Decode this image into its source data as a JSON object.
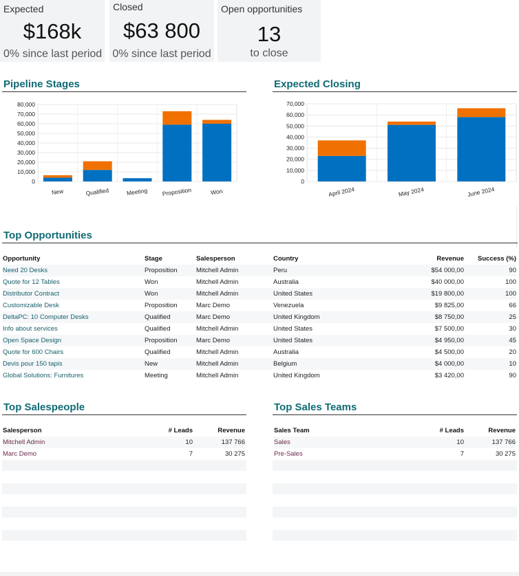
{
  "kpis": {
    "expected": {
      "label": "Expected",
      "value": "$168k",
      "sub": "0% since last period"
    },
    "closed": {
      "label": "Closed",
      "value": "$63 800",
      "sub": "0% since last period"
    },
    "open": {
      "label": "Open opportunities",
      "value": "13",
      "sub": "to close"
    }
  },
  "sections": {
    "pipeline": "Pipeline Stages",
    "closing": "Expected Closing",
    "top_opps": "Top Opportunities",
    "top_salespeople": "Top Salespeople",
    "top_teams": "Top Sales Teams"
  },
  "colors": {
    "primary": "#0070c0",
    "secondary": "#f07100",
    "title": "#0f6b73"
  },
  "chart_data": [
    {
      "type": "bar",
      "title": "Pipeline Stages",
      "stacked": true,
      "categories": [
        "New",
        "Qualified",
        "Meeting",
        "Proposition",
        "Won"
      ],
      "series": [
        {
          "values": [
            4000,
            12000,
            3420,
            59000,
            60000
          ]
        },
        {
          "values": [
            2500,
            9000,
            0,
            14000,
            4000
          ]
        }
      ],
      "ylim": [
        0,
        80000
      ],
      "y_ticks": [
        "80,000",
        "70,000",
        "60,000",
        "50,000",
        "40,000",
        "30,000",
        "20,000",
        "10,000",
        "0"
      ]
    },
    {
      "type": "bar",
      "title": "Expected Closing",
      "stacked": true,
      "categories": [
        "April 2024",
        "May 2024",
        "June 2024"
      ],
      "series": [
        {
          "values": [
            23000,
            51000,
            58000
          ]
        },
        {
          "values": [
            14000,
            3000,
            8000
          ]
        }
      ],
      "ylim": [
        0,
        70000
      ],
      "y_ticks": [
        "70,000",
        "60,000",
        "50,000",
        "40,000",
        "30,000",
        "20,000",
        "10,000",
        "0"
      ]
    }
  ],
  "opportunities": {
    "headers": {
      "opportunity": "Opportunity",
      "stage": "Stage",
      "salesperson": "Salesperson",
      "country": "Country",
      "revenue": "Revenue",
      "success": "Success (%)"
    },
    "rows": [
      [
        "Need 20 Desks",
        "Proposition",
        "Mitchell Admin",
        "Peru",
        "$54 000,00",
        "90"
      ],
      [
        "Quote for 12 Tables",
        "Won",
        "Mitchell Admin",
        "Australia",
        "$40 000,00",
        "100"
      ],
      [
        "Distributor Contract",
        "Won",
        "Mitchell Admin",
        "United States",
        "$19 800,00",
        "100"
      ],
      [
        "Customizable Desk",
        "Proposition",
        "Marc Demo",
        "Venezuela",
        "$9 825,00",
        "66"
      ],
      [
        "DeltaPC: 10 Computer Desks",
        "Qualified",
        "Marc Demo",
        "United Kingdom",
        "$8 750,00",
        "25"
      ],
      [
        "Info about services",
        "Qualified",
        "Mitchell Admin",
        "United States",
        "$7 500,00",
        "30"
      ],
      [
        "Open Space Design",
        "Proposition",
        "Marc Demo",
        "United States",
        "$4 950,00",
        "45"
      ],
      [
        "Quote for 600 Chairs",
        "Qualified",
        "Mitchell Admin",
        "Australia",
        "$4 500,00",
        "20"
      ],
      [
        "Devis pour 150 tapis",
        "New",
        "Mitchell Admin",
        "Belgium",
        "$4 000,00",
        "10"
      ],
      [
        "Global Solutions: Furnitures",
        "Meeting",
        "Mitchell Admin",
        "United Kingdom",
        "$3 420,00",
        "90"
      ]
    ]
  },
  "salespeople": {
    "headers": {
      "name": "Salesperson",
      "leads": "# Leads",
      "revenue": "Revenue"
    },
    "rows": [
      [
        "Mitchell Admin",
        "10",
        "137 766"
      ],
      [
        "Marc Demo",
        "7",
        "30 275"
      ]
    ]
  },
  "teams": {
    "headers": {
      "name": "Sales Team",
      "leads": "# Leads",
      "revenue": "Revenue"
    },
    "rows": [
      [
        "Sales",
        "10",
        "137 766"
      ],
      [
        "Pre-Sales",
        "7",
        "30 275"
      ]
    ]
  }
}
